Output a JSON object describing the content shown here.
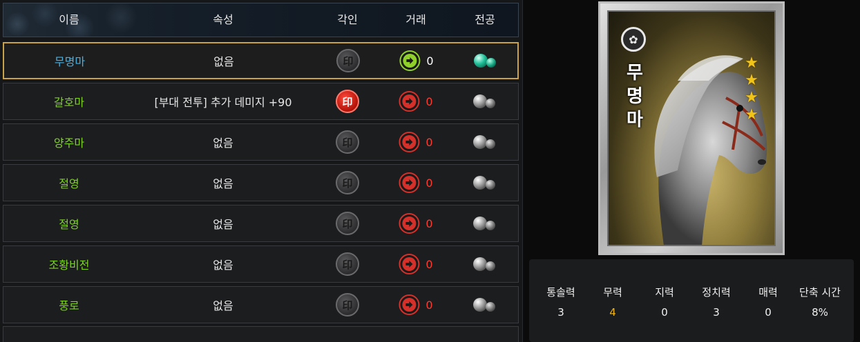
{
  "table": {
    "headers": {
      "name": "이름",
      "attribute": "속성",
      "engrave": "각인",
      "trade": "거래",
      "exploit": "전공"
    },
    "rows": [
      {
        "name": "무명마",
        "attribute": "없음",
        "seal": "印",
        "seal_active": false,
        "trade_count": "0",
        "trade_available": true,
        "exploit": "teal",
        "selected": true
      },
      {
        "name": "갈호마",
        "attribute": "[부대 전투] 추가 데미지 +90",
        "seal": "印",
        "seal_active": true,
        "trade_count": "0",
        "trade_available": false,
        "exploit": "gray",
        "selected": false
      },
      {
        "name": "양주마",
        "attribute": "없음",
        "seal": "印",
        "seal_active": false,
        "trade_count": "0",
        "trade_available": false,
        "exploit": "gray",
        "selected": false
      },
      {
        "name": "절영",
        "attribute": "없음",
        "seal": "印",
        "seal_active": false,
        "trade_count": "0",
        "trade_available": false,
        "exploit": "gray",
        "selected": false
      },
      {
        "name": "절영",
        "attribute": "없음",
        "seal": "印",
        "seal_active": false,
        "trade_count": "0",
        "trade_available": false,
        "exploit": "gray",
        "selected": false
      },
      {
        "name": "조황비전",
        "attribute": "없음",
        "seal": "印",
        "seal_active": false,
        "trade_count": "0",
        "trade_available": false,
        "exploit": "gray",
        "selected": false
      },
      {
        "name": "풍로",
        "attribute": "없음",
        "seal": "印",
        "seal_active": false,
        "trade_count": "0",
        "trade_available": false,
        "exploit": "gray",
        "selected": false
      }
    ]
  },
  "card": {
    "name_vertical": [
      "무",
      "명",
      "마"
    ],
    "emblem": "✿",
    "star_count": 4,
    "star_glyph": "★"
  },
  "stats": {
    "labels": [
      "통솔력",
      "무력",
      "지력",
      "정치력",
      "매력",
      "단축 시간"
    ],
    "values": [
      "3",
      "4",
      "0",
      "3",
      "0",
      "8%"
    ],
    "highlight_index": 1
  },
  "colors": {
    "selected_border": "#c9a24a",
    "name_green": "#7ed321",
    "name_selected": "#43b3e6",
    "trade_red": "#d6302a",
    "trade_green": "#8fd12a",
    "stat_highlight": "#f0b419"
  }
}
